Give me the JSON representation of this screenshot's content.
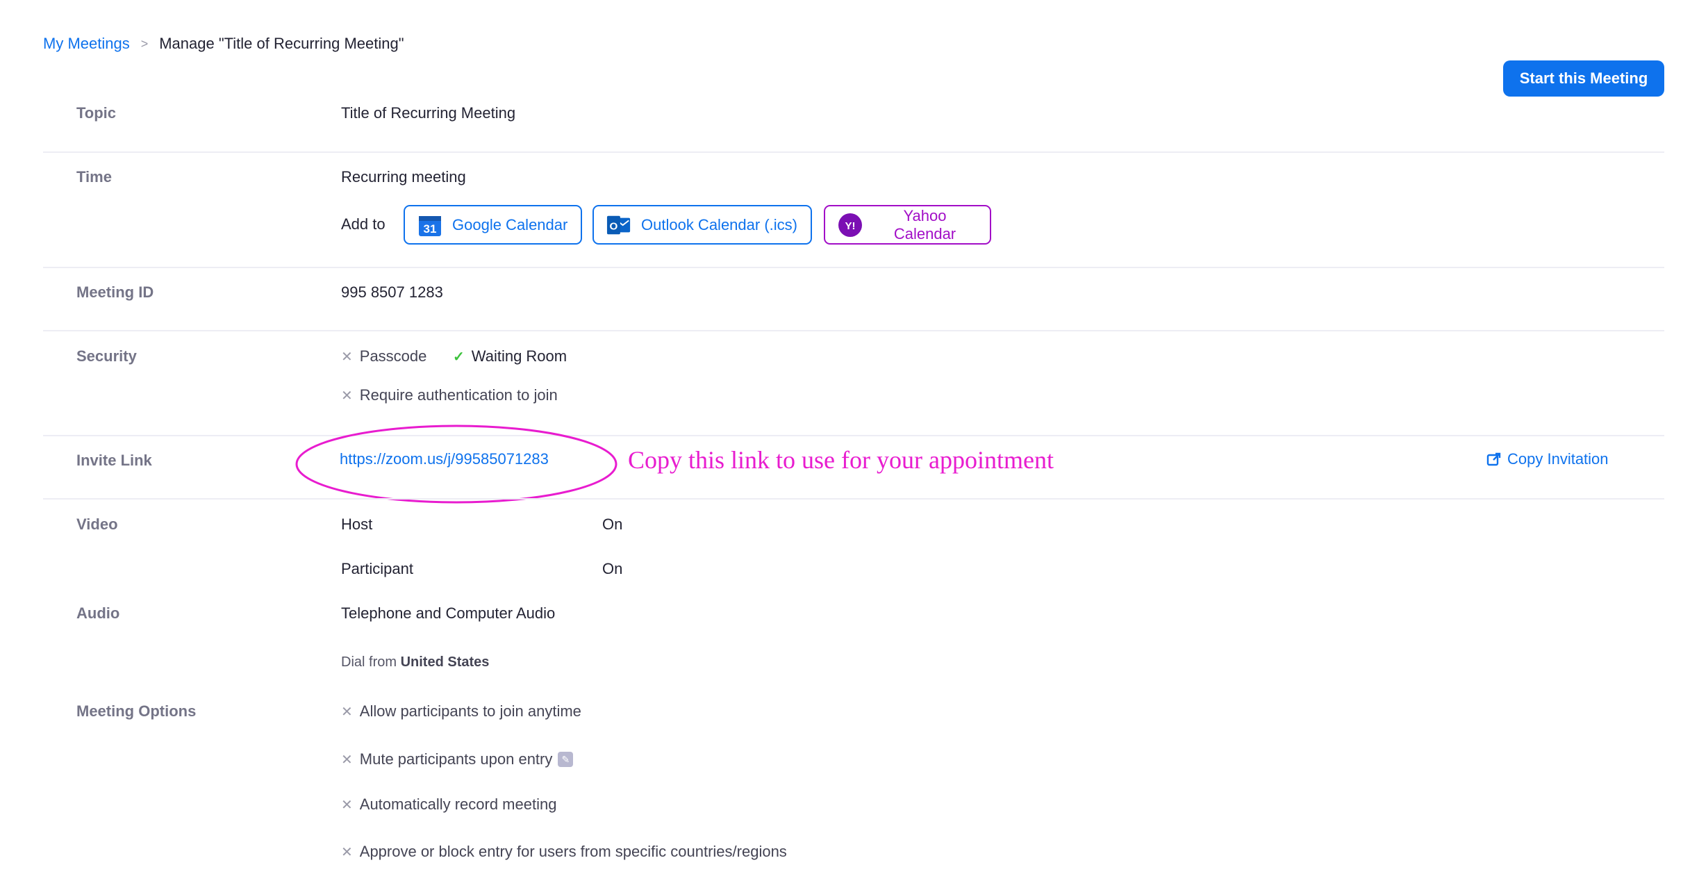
{
  "breadcrumb": {
    "parent": "My Meetings",
    "separator": ">",
    "current": "Manage \"Title of Recurring Meeting\""
  },
  "actions": {
    "start_label": "Start this Meeting",
    "copy_invitation_label": "Copy Invitation"
  },
  "labels": {
    "topic": "Topic",
    "time": "Time",
    "meeting_id": "Meeting ID",
    "security": "Security",
    "invite_link": "Invite Link",
    "video": "Video",
    "audio": "Audio",
    "meeting_options": "Meeting Options"
  },
  "topic": "Title of Recurring Meeting",
  "time": {
    "value": "Recurring meeting",
    "add_to_label": "Add to",
    "calendars": [
      {
        "label": "Google Calendar",
        "icon": "google-calendar-icon",
        "icon_text": "31",
        "color": "#0e72ed"
      },
      {
        "label": "Outlook Calendar (.ics)",
        "icon": "outlook-icon",
        "icon_text": "O",
        "color": "#0e72ed"
      },
      {
        "label": "Yahoo Calendar",
        "icon": "yahoo-icon",
        "icon_text": "Y!",
        "color": "#a20ec7"
      }
    ]
  },
  "meeting_id": "995 8507 1283",
  "security": {
    "passcode": {
      "label": "Passcode",
      "enabled": false
    },
    "waiting_room": {
      "label": "Waiting Room",
      "enabled": true
    },
    "require_auth": {
      "label": "Require authentication to join",
      "enabled": false
    }
  },
  "invite_link": "https://zoom.us/j/99585071283",
  "annotation": "Copy this link to use for your appointment",
  "video": {
    "host_label": "Host",
    "host_value": "On",
    "participant_label": "Participant",
    "participant_value": "On"
  },
  "audio": {
    "value": "Telephone and Computer Audio",
    "dial_from_label": "Dial from",
    "dial_from_country": "United States"
  },
  "meeting_options": [
    {
      "label": "Allow participants to join anytime",
      "enabled": false
    },
    {
      "label": "Mute participants upon entry",
      "enabled": false
    },
    {
      "label": "Automatically record meeting",
      "enabled": false
    },
    {
      "label": "Approve or block entry for users from specific countries/regions",
      "enabled": false
    }
  ],
  "colors": {
    "accent": "#0e72ed",
    "yahoo": "#a20ec7",
    "annotation": "#e81ccf",
    "check": "#3cc23c"
  }
}
